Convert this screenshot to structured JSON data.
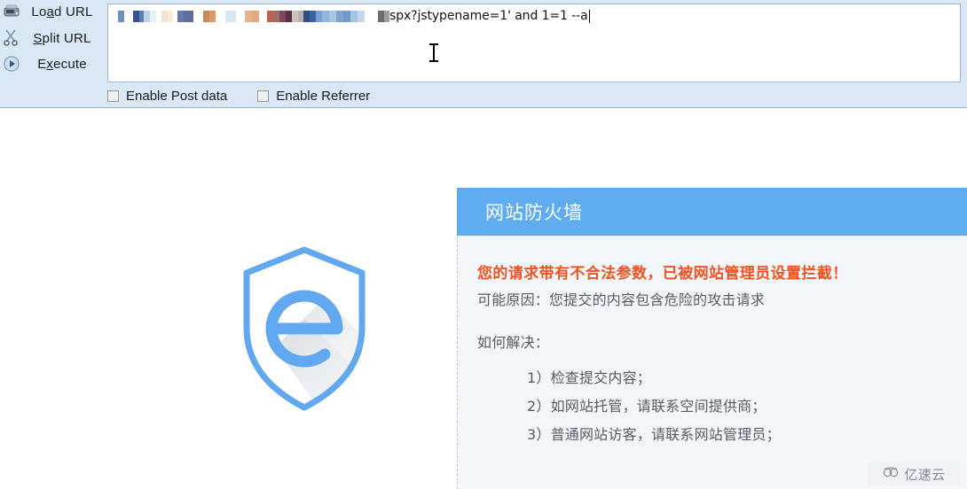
{
  "toolbar": {
    "buttons": [
      {
        "label_pre": "Lo",
        "label_accel": "a",
        "label_post": "d URL",
        "icon": "scanner-icon"
      },
      {
        "label_pre": "",
        "label_accel": "S",
        "label_post": "plit URL",
        "icon": "scissors-icon"
      },
      {
        "label_pre": "E",
        "label_accel": "x",
        "label_post": "ecute",
        "icon": "play-circle-icon"
      }
    ],
    "url_field": {
      "redacted": true,
      "visible_text": "spx?jstypename=1' and 1=1 --a",
      "caret_visible": true
    },
    "checkboxes": [
      {
        "label": "Enable Post data",
        "checked": false
      },
      {
        "label": "Enable Referrer",
        "checked": false
      }
    ]
  },
  "page": {
    "logo": {
      "icon": "shield-e-icon",
      "color": "#62a8f0"
    },
    "firewall": {
      "title": "网站防火墙",
      "header_color": "#5facf0",
      "alert": "您的请求带有不合法参数，已被网站管理员设置拦截！",
      "alert_color": "#f4511e",
      "reason": "可能原因：您提交的内容包含危险的攻击请求",
      "howto": "如何解决：",
      "steps": [
        "1）检查提交内容；",
        "2）如网站托管，请联系空间提供商；",
        "3）普通网站访客，请联系网站管理员；"
      ]
    },
    "watermark": {
      "text": "亿速云",
      "icon": "cloud-icon"
    }
  }
}
